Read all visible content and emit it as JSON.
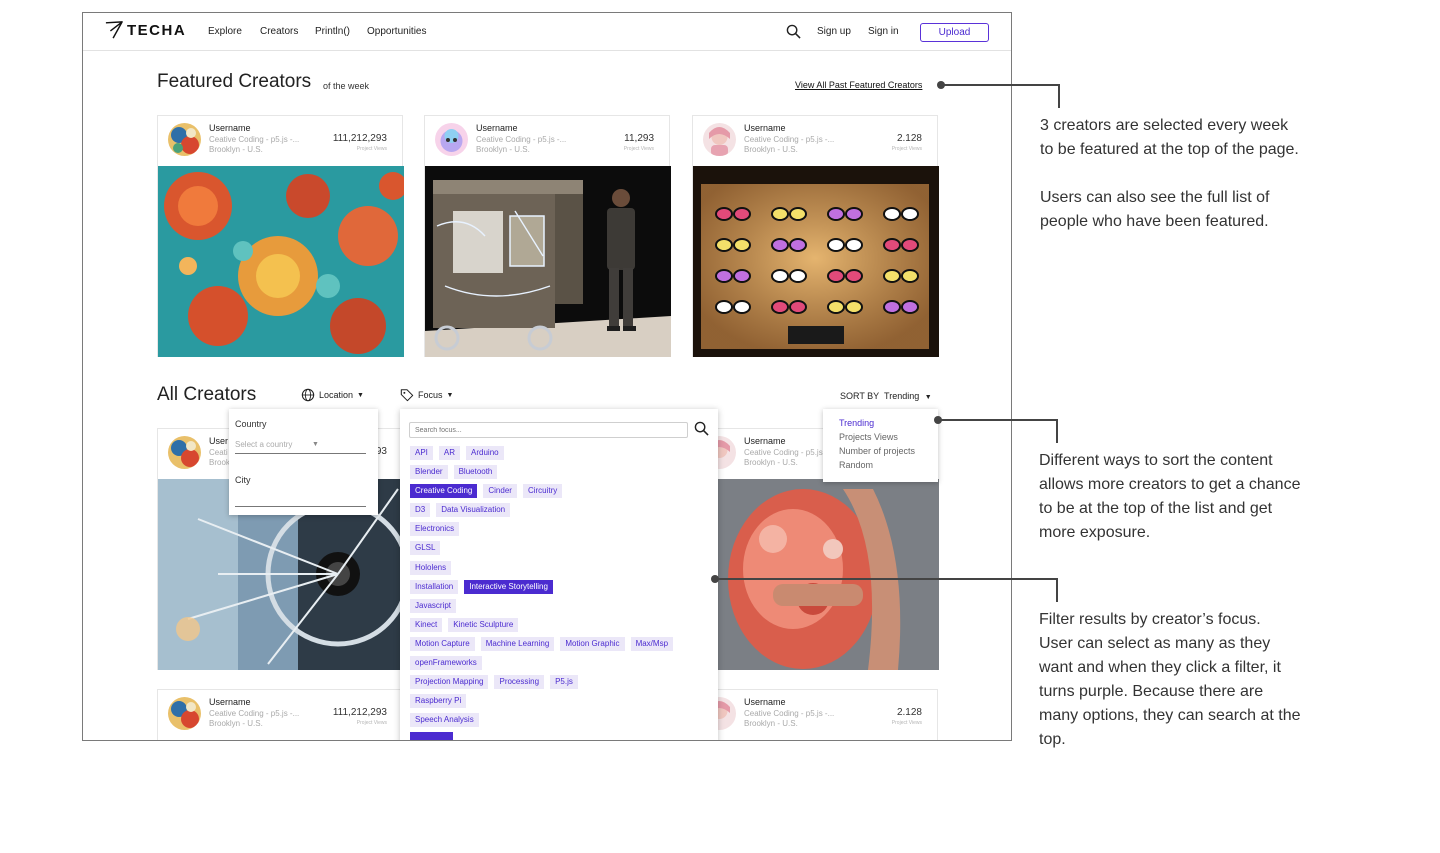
{
  "nav": {
    "logo": "TECHA",
    "links": [
      "Explore",
      "Creators",
      "Println()",
      "Opportunities"
    ],
    "sign_up": "Sign up",
    "sign_in": "Sign in",
    "upload": "Upload"
  },
  "featured": {
    "title": "Featured Creators",
    "subtitle": "of the week",
    "view_all": "View All Past Featured Creators",
    "cards": [
      {
        "username": "Username",
        "meta": "Ceative Coding - p5.js -...",
        "location": "Brooklyn - U.S.",
        "views": "111,212,293",
        "views_label": "Project Views"
      },
      {
        "username": "Username",
        "meta": "Ceative Coding - p5.js -...",
        "location": "Brooklyn - U.S.",
        "views": "11,293",
        "views_label": "Project Views"
      },
      {
        "username": "Username",
        "meta": "Ceative Coding - p5.js -...",
        "location": "Brooklyn - U.S.",
        "views": "2.128",
        "views_label": "Project Views"
      }
    ]
  },
  "all": {
    "title": "All Creators",
    "location_filter": "Location",
    "focus_filter": "Focus",
    "sort_label": "SORT BY",
    "sort_value": "Trending",
    "cards_row1": [
      {
        "username": "User",
        "meta": "Ceati",
        "location": "Brook",
        "views": "93"
      },
      {
        "username": "Username",
        "meta": "Ceative Coding - p5.js -...",
        "location": "Brooklyn - U.S.",
        "views": ""
      }
    ],
    "cards_row2": [
      {
        "username": "Username",
        "meta": "Ceative Coding - p5.js -...",
        "location": "Brooklyn - U.S.",
        "views": "111,212,293",
        "views_label": "Project Views"
      },
      {
        "username": "Username",
        "meta": "Ceative Coding - p5.js -...",
        "location": "Brooklyn - U.S.",
        "views": "2.128",
        "views_label": "Project Views"
      }
    ]
  },
  "location_dropdown": {
    "country_label": "Country",
    "country_placeholder": "Select a country",
    "city_label": "City"
  },
  "focus_dropdown": {
    "search_placeholder": "Search focus...",
    "rows": [
      [
        {
          "t": "API"
        },
        {
          "t": "AR"
        },
        {
          "t": "Arduino"
        }
      ],
      [
        {
          "t": "Blender"
        },
        {
          "t": "Bluetooth"
        }
      ],
      [
        {
          "t": "Creative Coding",
          "on": true
        },
        {
          "t": "Cinder"
        },
        {
          "t": "Circuitry"
        }
      ],
      [
        {
          "t": "D3"
        },
        {
          "t": "Data Visualization"
        }
      ],
      [
        {
          "t": "Electronics"
        }
      ],
      [
        {
          "t": "GLSL"
        }
      ],
      [
        {
          "t": "Hololens"
        }
      ],
      [
        {
          "t": "Installation"
        },
        {
          "t": "Interactive Storytelling",
          "on": true
        }
      ],
      [
        {
          "t": "Javascript"
        }
      ],
      [
        {
          "t": "Kinect"
        },
        {
          "t": "Kinetic Sculpture"
        }
      ],
      [
        {
          "t": "Motion Capture"
        },
        {
          "t": "Machine Learning"
        },
        {
          "t": "Motion Graphic"
        },
        {
          "t": "Max/Msp"
        }
      ],
      [
        {
          "t": "openFrameworks"
        }
      ],
      [
        {
          "t": "Projection Mapping"
        },
        {
          "t": "Processing"
        },
        {
          "t": "P5.js"
        }
      ],
      [
        {
          "t": "Raspberry Pi"
        }
      ],
      [
        {
          "t": "Speech Analysis"
        }
      ],
      [
        {
          "t": "",
          "on": true
        }
      ]
    ]
  },
  "sort_dropdown": {
    "options": [
      "Trending",
      "Projects Views",
      "Number of projects",
      "Random"
    ],
    "active": 0
  },
  "annotations": {
    "featured_note": [
      "3 creators are selected every week",
      "to be featured at the top of the page.",
      "",
      "Users can also see the full list of",
      "people who have been featured."
    ],
    "sort_note": [
      "Different ways to sort the content",
      "allows more creators to get a chance",
      "to be at the top of the list and get",
      "more exposure."
    ],
    "filter_note": [
      "Filter results by creator’s focus.",
      "User can select as many as they",
      "want and when they click a filter, it",
      "turns purple. Because there are",
      "many options, they can search at the",
      "top."
    ]
  },
  "colors": {
    "accent": "#4b2bd0",
    "tag_bg": "#ebe7f8"
  }
}
